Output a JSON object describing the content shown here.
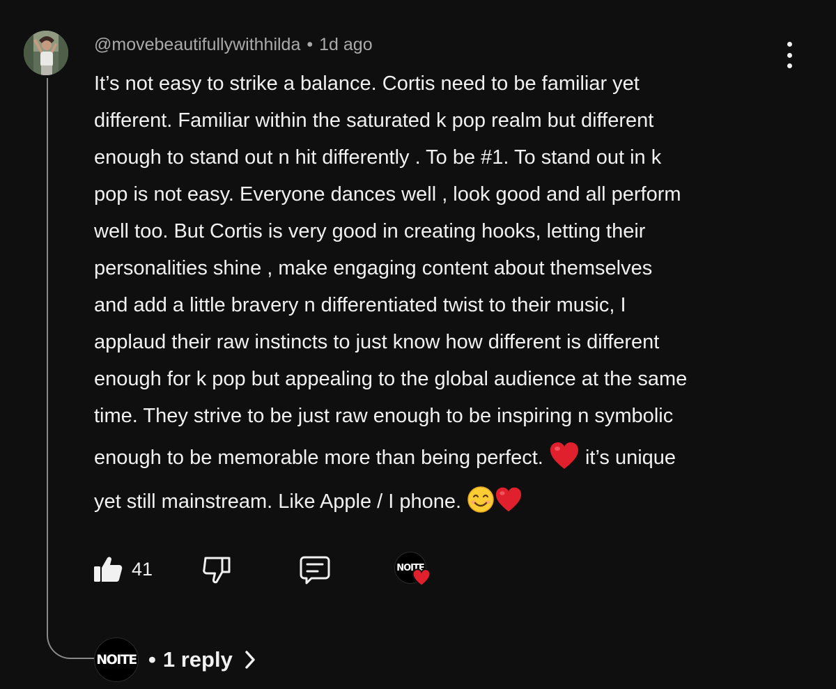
{
  "comment": {
    "author": "@movebeautifullywithhilda",
    "separator": "•",
    "time": "1d ago",
    "lines": [
      "It’s not easy to strike a balance. Cortis need to be familiar yet",
      "different. Familiar within the saturated k pop realm but different",
      "enough to stand out n hit differently . To be #1. To stand out in k",
      "pop is not easy. Everyone dances well , look good and all perform",
      "well too. But Cortis is very good in creating hooks, letting their",
      "personalities shine , make engaging content about themselves",
      "and add a little bravery n differentiated twist to their music, I",
      "applaud their raw instincts to just know how different is different",
      "enough for k pop but appealing to the global audience at the same",
      "time. They strive to be just raw enough to be inspiring n symbolic"
    ],
    "line11_before": "enough to be memorable more than being perfect.",
    "line11_after": "it’s unique",
    "line12": "yet still mainstream. Like Apple / I phone."
  },
  "actions": {
    "like_count": "41"
  },
  "creator": {
    "badge_text": "NOITE"
  },
  "replies": {
    "separator": "•",
    "label": "1 reply"
  },
  "colors": {
    "background": "#0f0f0f",
    "text": "#f1f1f1",
    "meta": "#aaaaaa",
    "heart": "#e0202d",
    "thread_line": "#8a8a8a"
  },
  "icons": {
    "like": "thumbs-up-filled-icon",
    "dislike": "thumbs-down-outline-icon",
    "reply": "comment-bubble-icon",
    "menu": "three-dots-vertical-icon",
    "creator_heart": "heart-icon",
    "expand": "chevron-right-icon"
  }
}
